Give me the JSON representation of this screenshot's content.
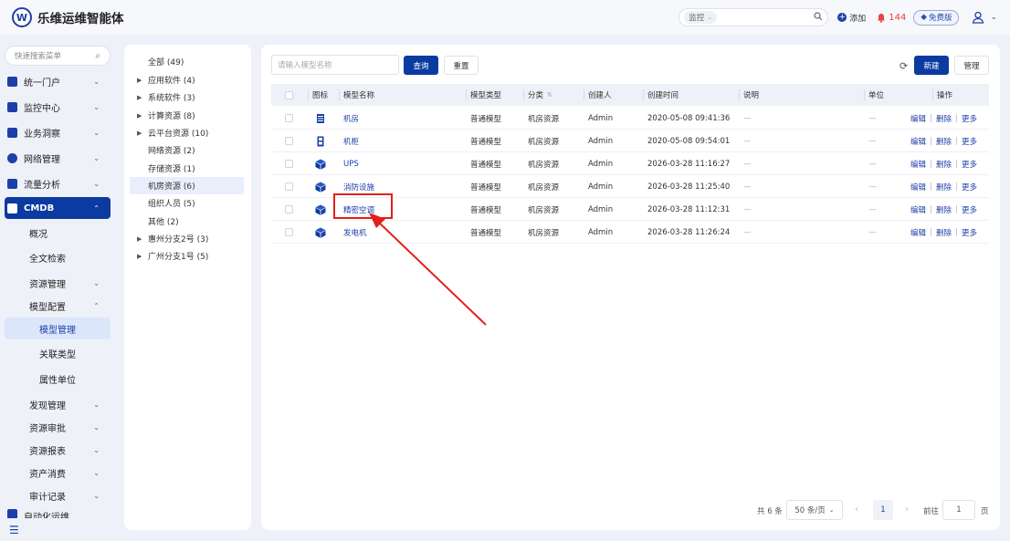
{
  "app": {
    "title": "乐维运维智能体",
    "logo_letter": "W"
  },
  "header": {
    "search_select": "监控",
    "add_label": "添加",
    "alert_count": "144",
    "free_label": "免费版"
  },
  "sidebar": {
    "search_placeholder": "快速搜索菜单",
    "items": [
      {
        "label": "统一门户"
      },
      {
        "label": "监控中心"
      },
      {
        "label": "业务洞察"
      },
      {
        "label": "网络管理"
      },
      {
        "label": "流量分析"
      },
      {
        "label": "CMDB"
      }
    ],
    "cmdb_sub": [
      {
        "label": "概况"
      },
      {
        "label": "全文检索"
      },
      {
        "label": "资源管理"
      },
      {
        "label": "模型配置"
      }
    ],
    "model_config_sub": [
      {
        "label": "模型管理"
      },
      {
        "label": "关联类型"
      },
      {
        "label": "属性单位"
      }
    ],
    "more_sub": [
      {
        "label": "发现管理"
      },
      {
        "label": "资源审批"
      },
      {
        "label": "资源报表"
      },
      {
        "label": "资产消费"
      },
      {
        "label": "审计记录"
      }
    ],
    "partial_item": "自动化运维"
  },
  "tree": {
    "items": [
      {
        "label": "全部 (49)"
      },
      {
        "label": "应用软件 (4)"
      },
      {
        "label": "系统软件 (3)"
      },
      {
        "label": "计算资源 (8)"
      },
      {
        "label": "云平台资源 (10)"
      },
      {
        "label": "网络资源 (2)"
      },
      {
        "label": "存储资源 (1)"
      },
      {
        "label": "机房资源 (6)"
      },
      {
        "label": "组织人员 (5)"
      },
      {
        "label": "其他 (2)"
      },
      {
        "label": "惠州分支2号 (3)"
      },
      {
        "label": "广州分支1号 (5)"
      }
    ]
  },
  "toolbar": {
    "search_placeholder": "请输入模型名称",
    "query_label": "查询",
    "reset_label": "重置",
    "new_label": "新建",
    "manage_label": "管理"
  },
  "table": {
    "headers": {
      "icon": "图标",
      "name": "模型名称",
      "type": "模型类型",
      "category": "分类",
      "creator": "创建人",
      "created": "创建时间",
      "desc": "说明",
      "unit": "单位",
      "ops": "操作"
    },
    "rows": [
      {
        "icon": "server-rack-icon",
        "name": "机房",
        "type": "普通模型",
        "category": "机房资源",
        "creator": "Admin",
        "created": "2020-05-08 09:41:36",
        "desc": "—",
        "unit": "—"
      },
      {
        "icon": "cabinet-icon",
        "name": "机柜",
        "type": "普通模型",
        "category": "机房资源",
        "creator": "Admin",
        "created": "2020-05-08 09:54:01",
        "desc": "—",
        "unit": "—"
      },
      {
        "icon": "cube-icon",
        "name": "UPS",
        "type": "普通模型",
        "category": "机房资源",
        "creator": "Admin",
        "created": "2026-03-28 11:16:27",
        "desc": "—",
        "unit": "—"
      },
      {
        "icon": "cube-icon",
        "name": "消防设施",
        "type": "普通模型",
        "category": "机房资源",
        "creator": "Admin",
        "created": "2026-03-28 11:25:40",
        "desc": "—",
        "unit": "—"
      },
      {
        "icon": "cube-icon",
        "name": "精密空调",
        "type": "普通模型",
        "category": "机房资源",
        "creator": "Admin",
        "created": "2026-03-28 11:12:31",
        "desc": "—",
        "unit": "—"
      },
      {
        "icon": "cube-icon",
        "name": "发电机",
        "type": "普通模型",
        "category": "机房资源",
        "creator": "Admin",
        "created": "2026-03-28 11:26:24",
        "desc": "—",
        "unit": "—"
      }
    ],
    "ops": {
      "edit": "编辑",
      "delete": "删除",
      "more": "更多"
    }
  },
  "pagination": {
    "total": "共 6 条",
    "page_size": "50 条/页",
    "current": "1",
    "goto_label": "前往",
    "goto_value": "1",
    "page_suffix": "页"
  },
  "colors": {
    "primary": "#0b3aa0",
    "highlight": "#e0201c"
  }
}
